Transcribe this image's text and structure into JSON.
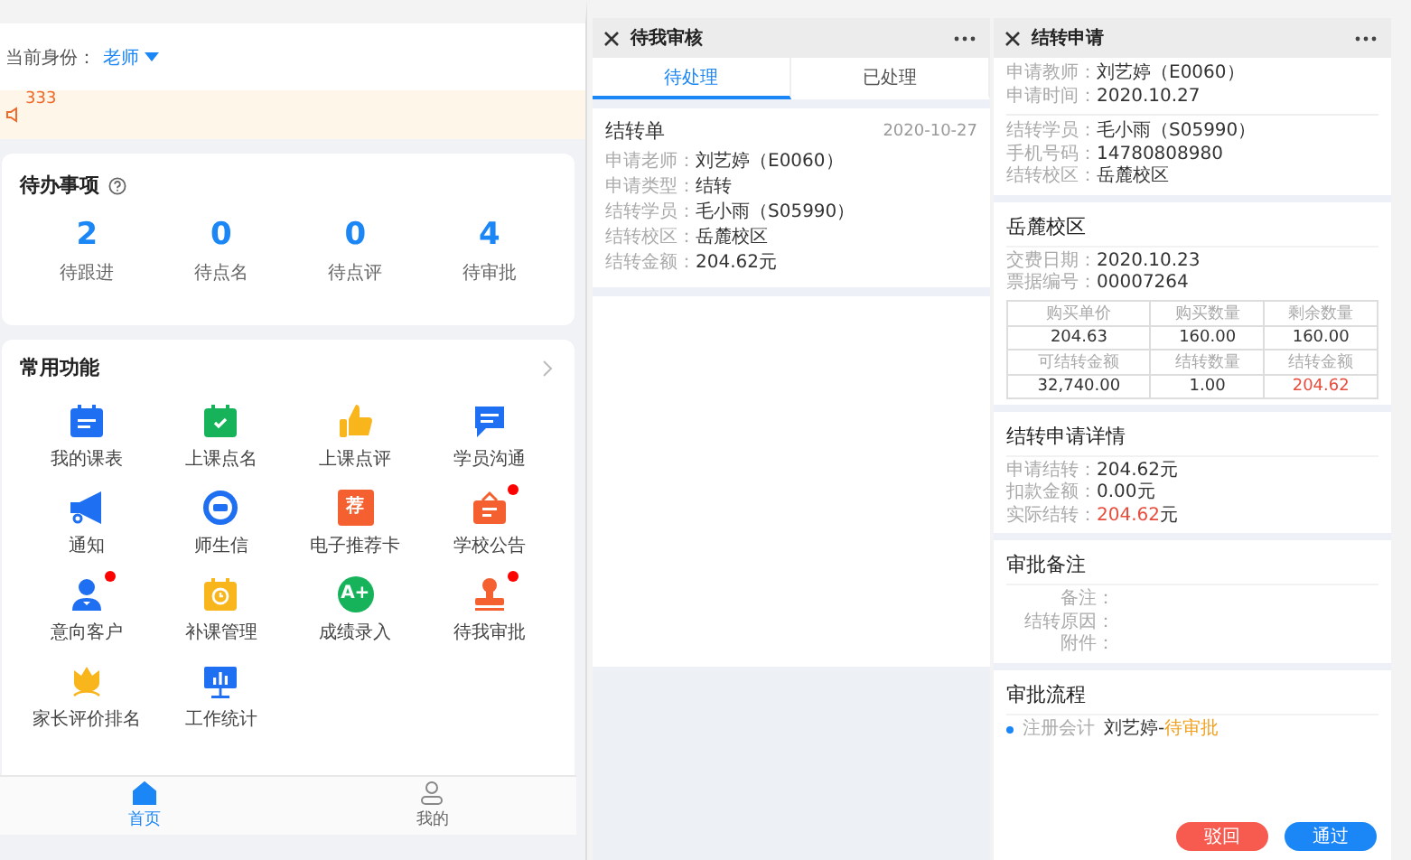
{
  "home": {
    "identity_label": "当前身份：",
    "identity_value": "老师",
    "notice": {
      "text": "333"
    },
    "todo": {
      "title": "待办事项",
      "items": [
        {
          "count": "2",
          "label": "待跟进"
        },
        {
          "count": "0",
          "label": "待点名"
        },
        {
          "count": "0",
          "label": "待点评"
        },
        {
          "count": "4",
          "label": "待审批"
        }
      ]
    },
    "functions": {
      "title": "常用功能",
      "items": [
        {
          "label": "我的课表",
          "kind": "calendar",
          "dot": false
        },
        {
          "label": "上课点名",
          "kind": "check",
          "dot": false
        },
        {
          "label": "上课点评",
          "kind": "thumb",
          "dot": false
        },
        {
          "label": "学员沟通",
          "kind": "chat",
          "dot": false
        },
        {
          "label": "通知",
          "kind": "megaphone",
          "dot": false
        },
        {
          "label": "师生信",
          "kind": "message",
          "dot": false
        },
        {
          "label": "电子推荐卡",
          "kind": "card",
          "glyph": "荐",
          "dot": false
        },
        {
          "label": "学校公告",
          "kind": "board",
          "dot": true
        },
        {
          "label": "意向客户",
          "kind": "person",
          "dot": true
        },
        {
          "label": "补课管理",
          "kind": "clock",
          "dot": false
        },
        {
          "label": "成绩录入",
          "kind": "grade",
          "glyph": "A+",
          "dot": false
        },
        {
          "label": "待我审批",
          "kind": "stamp",
          "dot": true
        },
        {
          "label": "家长评价排名",
          "kind": "flower",
          "dot": false
        },
        {
          "label": "工作统计",
          "kind": "monitor",
          "dot": false
        }
      ]
    },
    "tabbar": [
      {
        "label": "首页",
        "kind": "home",
        "selected": true
      },
      {
        "label": "我的",
        "kind": "user",
        "selected": false
      }
    ]
  },
  "review": {
    "title": "待我审核",
    "tabs": [
      {
        "label": "待处理",
        "selected": true
      },
      {
        "label": "已处理",
        "selected": false
      }
    ],
    "card": {
      "title": "结转单",
      "date": "2020-10-27",
      "fields": [
        {
          "label": "申请老师：",
          "value": "刘艺婷（E0060）"
        },
        {
          "label": "申请类型：",
          "value": "结转"
        },
        {
          "label": "结转学员：",
          "value": "毛小雨（S05990）"
        },
        {
          "label": "结转校区：",
          "value": "岳麓校区"
        },
        {
          "label": "结转金额：",
          "value": "204.62元"
        }
      ]
    }
  },
  "application": {
    "title": "结转申请",
    "applicant": [
      {
        "label": "申请教师：",
        "value": "刘艺婷（E0060）"
      },
      {
        "label": "申请时间：",
        "value": "2020.10.27"
      }
    ],
    "student": [
      {
        "label": "结转学员：",
        "value": "毛小雨（S05990）"
      },
      {
        "label": "手机号码：",
        "value": "14780808980"
      },
      {
        "label": "结转校区：",
        "value": "岳麓校区"
      }
    ],
    "campus": {
      "title": "岳麓校区",
      "fields": [
        {
          "label": "交费日期：",
          "value": "2020.10.23"
        },
        {
          "label": "票据编号：",
          "value": "00007264"
        }
      ],
      "table": [
        {
          "kind": "head",
          "cells": [
            {
              "text": "购买单价",
              "highlight": false
            },
            {
              "text": "购买数量",
              "highlight": false
            },
            {
              "text": "剩余数量",
              "highlight": false
            }
          ]
        },
        {
          "kind": "value",
          "cells": [
            {
              "text": "204.63",
              "highlight": false
            },
            {
              "text": "160.00",
              "highlight": false
            },
            {
              "text": "160.00",
              "highlight": false
            }
          ]
        },
        {
          "kind": "head",
          "cells": [
            {
              "text": "可结转金额",
              "highlight": false
            },
            {
              "text": "结转数量",
              "highlight": false
            },
            {
              "text": "结转金额",
              "highlight": false
            }
          ]
        },
        {
          "kind": "value",
          "cells": [
            {
              "text": "32,740.00",
              "highlight": false
            },
            {
              "text": "1.00",
              "highlight": false
            },
            {
              "text": "204.62",
              "highlight": true
            }
          ]
        }
      ]
    },
    "details": {
      "title": "结转申请详情",
      "fields": [
        {
          "label": "申请结转：",
          "value": "204.62",
          "unit": "元",
          "highlight": false
        },
        {
          "label": "扣款金额：",
          "value": "0.00",
          "unit": "元",
          "highlight": false
        },
        {
          "label": "实际结转：",
          "value": "204.62",
          "unit": "元",
          "highlight": true
        }
      ]
    },
    "remarks": {
      "title": "审批备注",
      "fields": [
        {
          "label": "备注："
        },
        {
          "label": "结转原因："
        },
        {
          "label": "附件："
        }
      ]
    },
    "flow": {
      "title": "审批流程",
      "steps": [
        {
          "role": "注册会计",
          "name": "刘艺婷-",
          "status": "待审批"
        }
      ]
    },
    "buttons": [
      {
        "label": "驳回",
        "kind": "reject"
      },
      {
        "label": "通过",
        "kind": "approve"
      }
    ]
  }
}
